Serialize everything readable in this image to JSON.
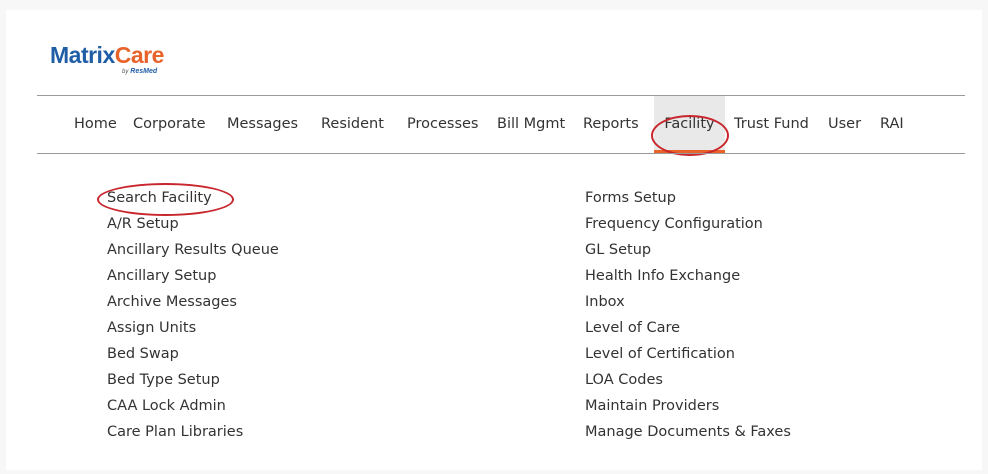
{
  "brand": {
    "name_part1": "Matrix",
    "name_part2": "Care",
    "byline_prefix": "by",
    "byline_company": "ResMed"
  },
  "colors": {
    "brand_blue": "#1f5da6",
    "brand_orange": "#e8622a",
    "annotation_red": "#c8262c",
    "active_tab_bg": "#e9e9e9"
  },
  "nav": {
    "items": [
      {
        "label": "Home"
      },
      {
        "label": "Corporate"
      },
      {
        "label": "Messages"
      },
      {
        "label": "Resident"
      },
      {
        "label": "Processes"
      },
      {
        "label": "Bill Mgmt"
      },
      {
        "label": "Reports"
      },
      {
        "label": "Facility",
        "active": true
      },
      {
        "label": "Trust Fund"
      },
      {
        "label": "User"
      },
      {
        "label": "RAI"
      }
    ]
  },
  "menu": {
    "left": [
      "Search Facility",
      "A/R Setup",
      "Ancillary Results Queue",
      "Ancillary Setup",
      "Archive Messages",
      "Assign Units",
      "Bed Swap",
      "Bed Type Setup",
      "CAA Lock Admin",
      "Care Plan Libraries"
    ],
    "right": [
      "Forms Setup",
      "Frequency Configuration",
      "GL Setup",
      "Health Info Exchange",
      "Inbox",
      "Level of Care",
      "Level of Certification",
      "LOA Codes",
      "Maintain Providers",
      "Manage Documents & Faxes"
    ]
  }
}
